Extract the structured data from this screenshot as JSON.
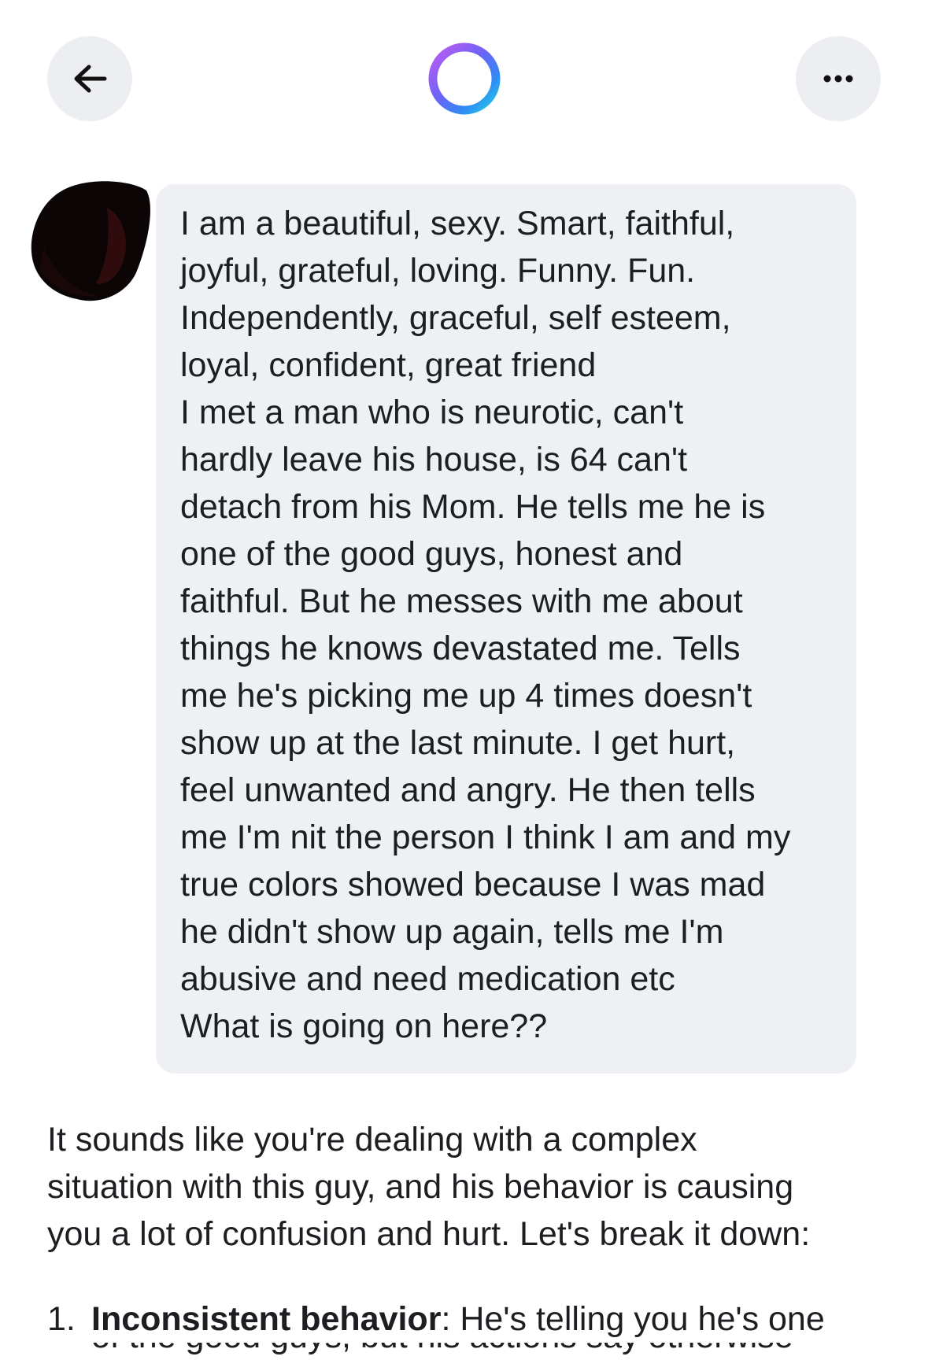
{
  "header": {
    "back_icon": "arrow-left-icon",
    "logo_icon": "meta-ai-ring-icon",
    "more_icon": "more-horizontal-icon",
    "logo_gradient": [
      "#a45cf5",
      "#2f6cf6",
      "#28c8e6"
    ]
  },
  "user_message": {
    "avatar_icon": "redacted-avatar",
    "text": "I am a beautiful,  sexy. Smart, faithful,\njoyful, grateful, loving. Funny. Fun.\nIndependently, graceful, self esteem,\nloyal, confident, great friend\nI met a man who is neurotic,  can't\nhardly leave his house, is 64 can't\ndetach from his Mom. He tells me he is\none of the good guys, honest and\nfaithful.  But he messes with me about\nthings he knows devastated me. Tells\nme he's picking me up 4 times doesn't\nshow up at the last minute.  I get hurt,\nfeel unwanted and angry. He then tells\nme I'm nit the person I think I am and my\ntrue colors showed because I was mad\nhe didn't show up again, tells me I'm\nabusive and need medication etc\nWhat is going on here??"
  },
  "ai_reply": {
    "intro": "It sounds like you're dealing with a complex\nsituation with this guy, and his behavior is causing\nyou a lot of confusion and hurt. Let's break it down:",
    "list": [
      {
        "number": "1.",
        "title": "Inconsistent behavior",
        "text": ": He's telling you he's one",
        "cutoff_text": "of the good guys, but his actions say otherwise"
      }
    ]
  },
  "colors": {
    "bubble_bg": "#eef0f3",
    "button_bg": "#eceef1",
    "text": "#1c1e21"
  }
}
